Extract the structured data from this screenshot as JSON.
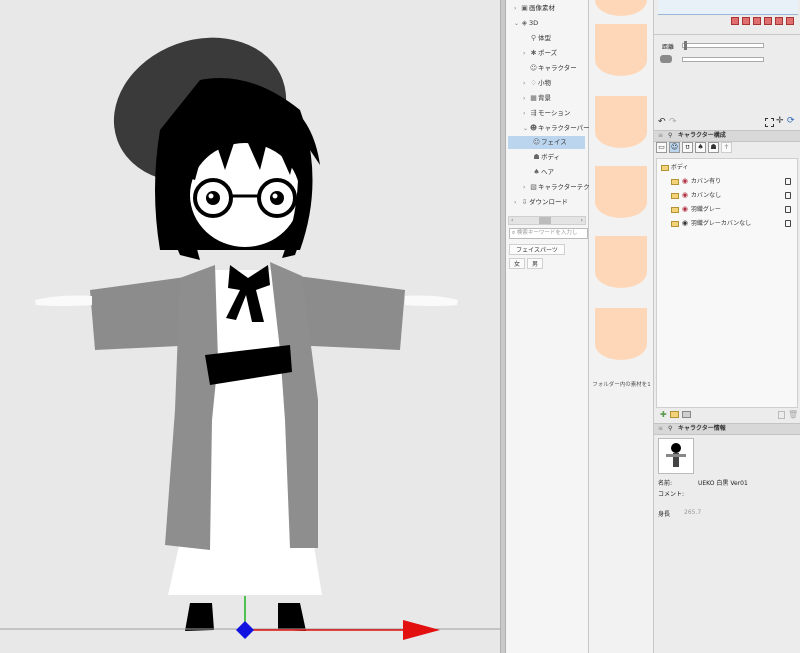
{
  "tree": {
    "items": [
      {
        "label": "画像素材",
        "icon": "▣",
        "expanded": false
      },
      {
        "label": "3D",
        "icon": "◈",
        "expanded": true
      },
      {
        "label": "体型",
        "icon": "⚲"
      },
      {
        "label": "ポーズ",
        "icon": "✱",
        "expanded": false
      },
      {
        "label": "キャラクター",
        "icon": "☺"
      },
      {
        "label": "小物",
        "icon": "♢",
        "expanded": false
      },
      {
        "label": "背景",
        "icon": "▦",
        "expanded": false
      },
      {
        "label": "モーション",
        "icon": "⇶",
        "expanded": false
      },
      {
        "label": "キャラクターパー",
        "icon": "☻",
        "expanded": true
      },
      {
        "label": "フェイス",
        "icon": "☺",
        "selected": true
      },
      {
        "label": "ボディ",
        "icon": "☗"
      },
      {
        "label": "ヘア",
        "icon": "♠"
      },
      {
        "label": "キャラクターテク",
        "icon": "▧",
        "expanded": false
      },
      {
        "label": "ダウンロード",
        "icon": "⇩",
        "expanded": false
      }
    ],
    "search_placeholder": "検索キーワードを入力し",
    "tag_buttons": [
      "フェイスパーツ",
      "女",
      "男"
    ]
  },
  "thumbnails": {
    "count": 5,
    "skin_color": "#fdd7b8",
    "footer": "フォルダー内の素材を1"
  },
  "properties": {
    "distance_label": "距離"
  },
  "char_structure": {
    "title": "キャラクター構成",
    "root": "ボディ",
    "items": [
      {
        "label": "カバン有り"
      },
      {
        "label": "カバンなし"
      },
      {
        "label": "羽織グレー"
      },
      {
        "label": "羽織グレーカバンなし"
      }
    ]
  },
  "char_info": {
    "title": "キャラクター情報",
    "name_label": "名前:",
    "name_value": "UEKO 白黒 Ver01",
    "comment_label": "コメント:",
    "height_label": "身長",
    "height_value": "265.7"
  },
  "colors": {
    "selection": "#bcd5ef",
    "axis_x": "#e31010",
    "axis_y": "#1eb41e",
    "axis_origin": "#1212e0"
  }
}
